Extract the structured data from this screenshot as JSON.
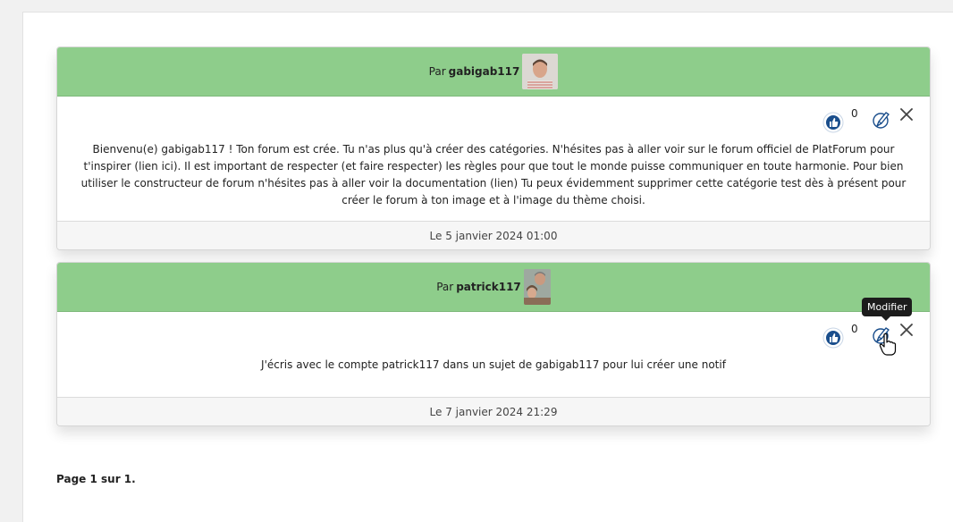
{
  "posts": [
    {
      "by_label": "Par",
      "author": "gabigab117",
      "likes": "0",
      "body": "Bienvenu(e) gabigab117 ! Ton forum est crée. Tu n'as plus qu'à créer des catégories. N'hésites pas à aller voir sur le forum officiel de PlatForum pour t'inspirer (lien ici). Il est important de respecter (et faire respecter) les règles pour que tout le monde puisse communiquer en toute harmonie. Pour bien utiliser le constructeur de forum n'hésites pas à aller voir la documentation (lien) Tu peux évidemment supprimer cette catégorie test dès à présent pour créer le forum à ton image et à l'image du thème choisi.",
      "date": "Le 5 janvier 2024 01:00"
    },
    {
      "by_label": "Par",
      "author": "patrick117",
      "likes": "0",
      "body": "J'écris avec le compte patrick117 dans un sujet de gabigab117 pour lui créer une notif",
      "date": "Le 7 janvier 2024 21:29"
    }
  ],
  "tooltip": "Modifier",
  "pagination": "Page 1 sur 1.",
  "colors": {
    "header_green": "#8ecd8b",
    "like_blue": "#1a4e8c"
  },
  "icons": [
    "like-icon",
    "edit-icon",
    "close-icon",
    "pointer-cursor-icon"
  ]
}
